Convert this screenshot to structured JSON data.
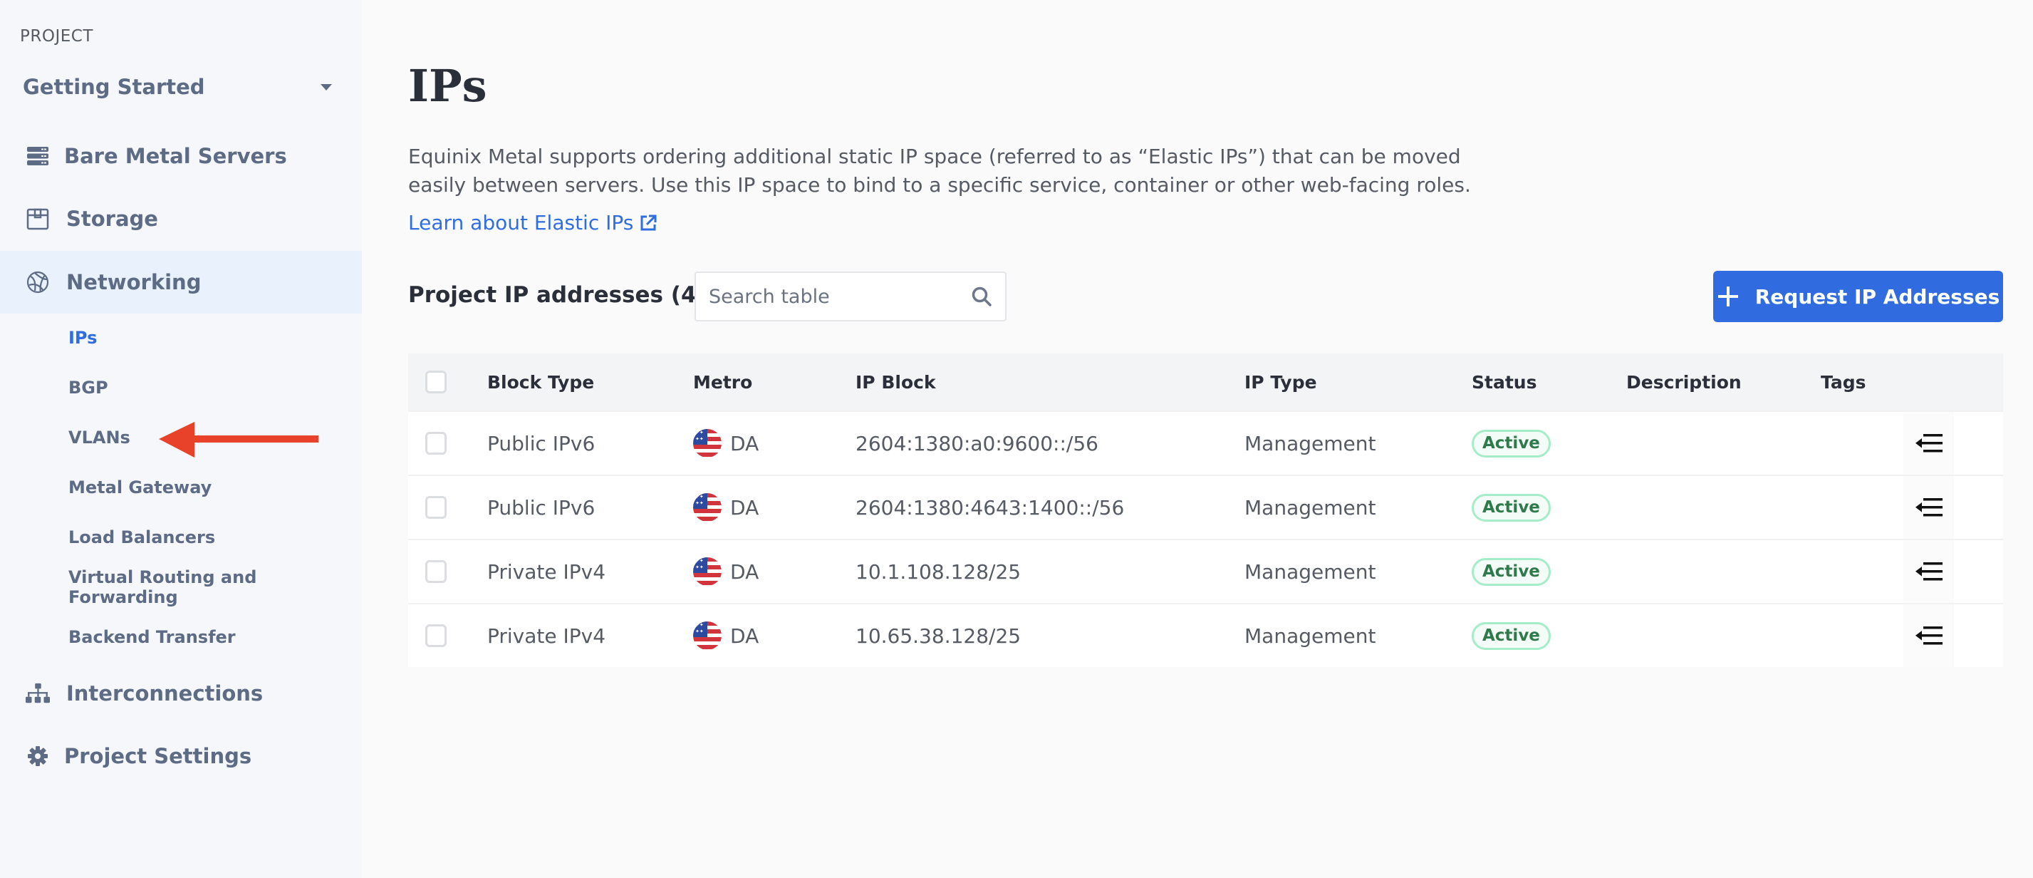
{
  "sidebar": {
    "project_label": "PROJECT",
    "project_name": "Getting Started",
    "nav": [
      {
        "label": "Bare Metal Servers",
        "icon": "server-icon"
      },
      {
        "label": "Storage",
        "icon": "storage-box-icon"
      },
      {
        "label": "Networking",
        "icon": "globe-network-icon",
        "active": true
      },
      {
        "label": "Interconnections",
        "icon": "sitemap-icon"
      },
      {
        "label": "Project Settings",
        "icon": "gear-icon"
      }
    ],
    "networking_sub": [
      {
        "label": "IPs",
        "active": true
      },
      {
        "label": "BGP"
      },
      {
        "label": "VLANs"
      },
      {
        "label": "Metal Gateway"
      },
      {
        "label": "Load Balancers"
      },
      {
        "label": "Virtual Routing and Forwarding"
      },
      {
        "label": "Backend Transfer"
      }
    ]
  },
  "annotation": {
    "type": "arrow",
    "points_to": "VLANs",
    "color": "#e8432a"
  },
  "main": {
    "title": "IPs",
    "intro": "Equinix Metal supports ordering additional static IP space (referred to as “Elastic IPs”) that can be moved easily between servers. Use this IP space to bind to a specific service, container or other web-facing roles.",
    "learn_link": "Learn about Elastic IPs",
    "table_heading": "Project IP addresses (4)",
    "search_placeholder": "Search table",
    "request_button": "Request IP Addresses",
    "columns": [
      "Block Type",
      "Metro",
      "IP Block",
      "IP Type",
      "Status",
      "Description",
      "Tags"
    ],
    "rows": [
      {
        "block_type": "Public IPv6",
        "metro": "DA",
        "ip_block": "2604:1380:a0:9600::/56",
        "ip_type": "Management",
        "status": "Active",
        "description": "",
        "tags": ""
      },
      {
        "block_type": "Public IPv6",
        "metro": "DA",
        "ip_block": "2604:1380:4643:1400::/56",
        "ip_type": "Management",
        "status": "Active",
        "description": "",
        "tags": ""
      },
      {
        "block_type": "Private IPv4",
        "metro": "DA",
        "ip_block": "10.1.108.128/25",
        "ip_type": "Management",
        "status": "Active",
        "description": "",
        "tags": ""
      },
      {
        "block_type": "Private IPv4",
        "metro": "DA",
        "ip_block": "10.65.38.128/25",
        "ip_type": "Management",
        "status": "Active",
        "description": "",
        "tags": ""
      }
    ]
  },
  "colors": {
    "accent": "#306ce0",
    "link": "#2f6ee0",
    "status_active": "#2e7a4b"
  }
}
